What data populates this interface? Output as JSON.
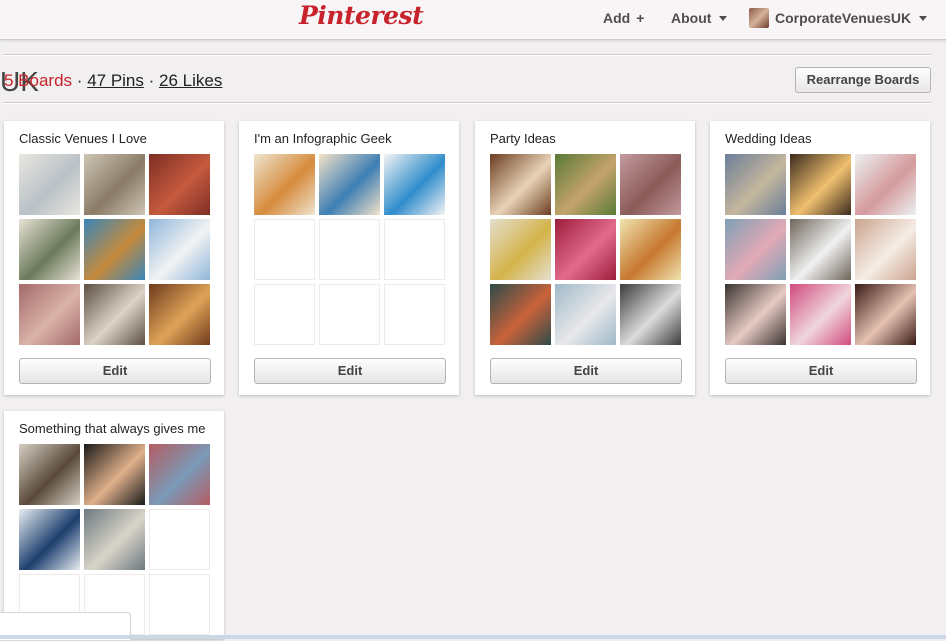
{
  "header": {
    "logo": "Pinterest",
    "add_label": "Add",
    "about_label": "About",
    "user_label": "CorporateVenuesUK"
  },
  "profile": {
    "ghost_text": "UK",
    "boards_count": "5 Boards",
    "pins_count": "47 Pins",
    "likes_count": "26 Likes",
    "separator": "·"
  },
  "rearrange_label": "Rearrange Boards",
  "edit_label": "Edit",
  "boards": [
    {
      "title": "Classic Venues I Love",
      "images": [
        [
          "#e9e6e0",
          "#b9c1c6"
        ],
        [
          "#cfc6b6",
          "#8a7b66"
        ],
        [
          "#7d2e24",
          "#c65a3e"
        ],
        [
          "#e8e2d6",
          "#6c7a5b"
        ],
        [
          "#3a86b9",
          "#c58a3c"
        ],
        [
          "#8fb6db",
          "#f2f2f2"
        ],
        [
          "#a46a6a",
          "#d9b2a8"
        ],
        [
          "#5d5044",
          "#dcd3c6"
        ],
        [
          "#6e3a1d",
          "#e0a457"
        ]
      ]
    },
    {
      "title": "I'm an Infographic Geek",
      "images": [
        [
          "#efe4cf",
          "#d68b3c"
        ],
        [
          "#f3e3c8",
          "#3d7eb5"
        ],
        [
          "#f4f4f4",
          "#2f8ccc"
        ]
      ]
    },
    {
      "title": "Party Ideas",
      "images": [
        [
          "#6b3d22",
          "#e9d3b6"
        ],
        [
          "#5a7a36",
          "#c4a36d"
        ],
        [
          "#c49a9e",
          "#8a5b58"
        ],
        [
          "#e4dfce",
          "#d4b34a"
        ],
        [
          "#9c1e3d",
          "#e36a8c"
        ],
        [
          "#f1e4b0",
          "#c5772e"
        ],
        [
          "#2d4b4a",
          "#c9623a"
        ],
        [
          "#9fb9c9",
          "#e8e8ea"
        ],
        [
          "#3c3c3c",
          "#dcdcdc"
        ]
      ]
    },
    {
      "title": "Wedding Ideas",
      "images": [
        [
          "#6b7e99",
          "#c5b79d"
        ],
        [
          "#3b2b1d",
          "#f0c070"
        ],
        [
          "#edf0f1",
          "#d49a9c"
        ],
        [
          "#7fa0b5",
          "#e2a9b6"
        ],
        [
          "#6e665c",
          "#f1f1f1"
        ],
        [
          "#caa48e",
          "#f6ece6"
        ],
        [
          "#3a3330",
          "#e7cac4"
        ],
        [
          "#d14a7d",
          "#f1d6dd"
        ],
        [
          "#3b1b17",
          "#e5c2b2"
        ]
      ]
    },
    {
      "title": "Something that always gives me",
      "images": [
        [
          "#d6cfc4",
          "#5a4a3a"
        ],
        [
          "#1a1a1a",
          "#e0b08a"
        ],
        [
          "#b45c62",
          "#7a9ab8"
        ],
        [
          "#e7ecf1",
          "#1d3f6e"
        ],
        [
          "#6d7a80",
          "#d9d4c8"
        ]
      ]
    }
  ]
}
